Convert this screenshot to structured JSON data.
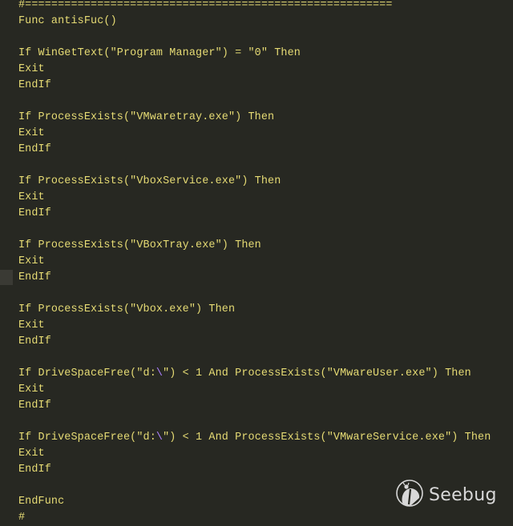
{
  "editor": {
    "theme_colors": {
      "background": "#272822",
      "text": "#e6db74",
      "escape": "#ae81ff"
    },
    "lines": [
      "#========================================================",
      "Func antisFuc()",
      "",
      "If WinGetText(\"Program Manager\") = \"0\" Then",
      "Exit",
      "EndIf",
      "",
      "If ProcessExists(\"VMwaretray.exe\") Then",
      "Exit",
      "EndIf",
      "",
      "If ProcessExists(\"VboxService.exe\") Then",
      "Exit",
      "EndIf",
      "",
      "If ProcessExists(\"VBoxTray.exe\") Then",
      "Exit",
      "EndIf",
      "",
      "If ProcessExists(\"Vbox.exe\") Then",
      "Exit",
      "EndIf",
      "",
      "If DriveSpaceFree(\"d:\\\") < 1 And ProcessExists(\"VMwareUser.exe\") Then",
      "Exit",
      "EndIf",
      "",
      "If DriveSpaceFree(\"d:\\\") < 1 And ProcessExists(\"VMwareService.exe\") Then",
      "Exit",
      "EndIf",
      "",
      "EndFunc",
      "#"
    ]
  },
  "watermark": {
    "icon": "seebug-ladybug-icon",
    "text": "Seebug"
  }
}
